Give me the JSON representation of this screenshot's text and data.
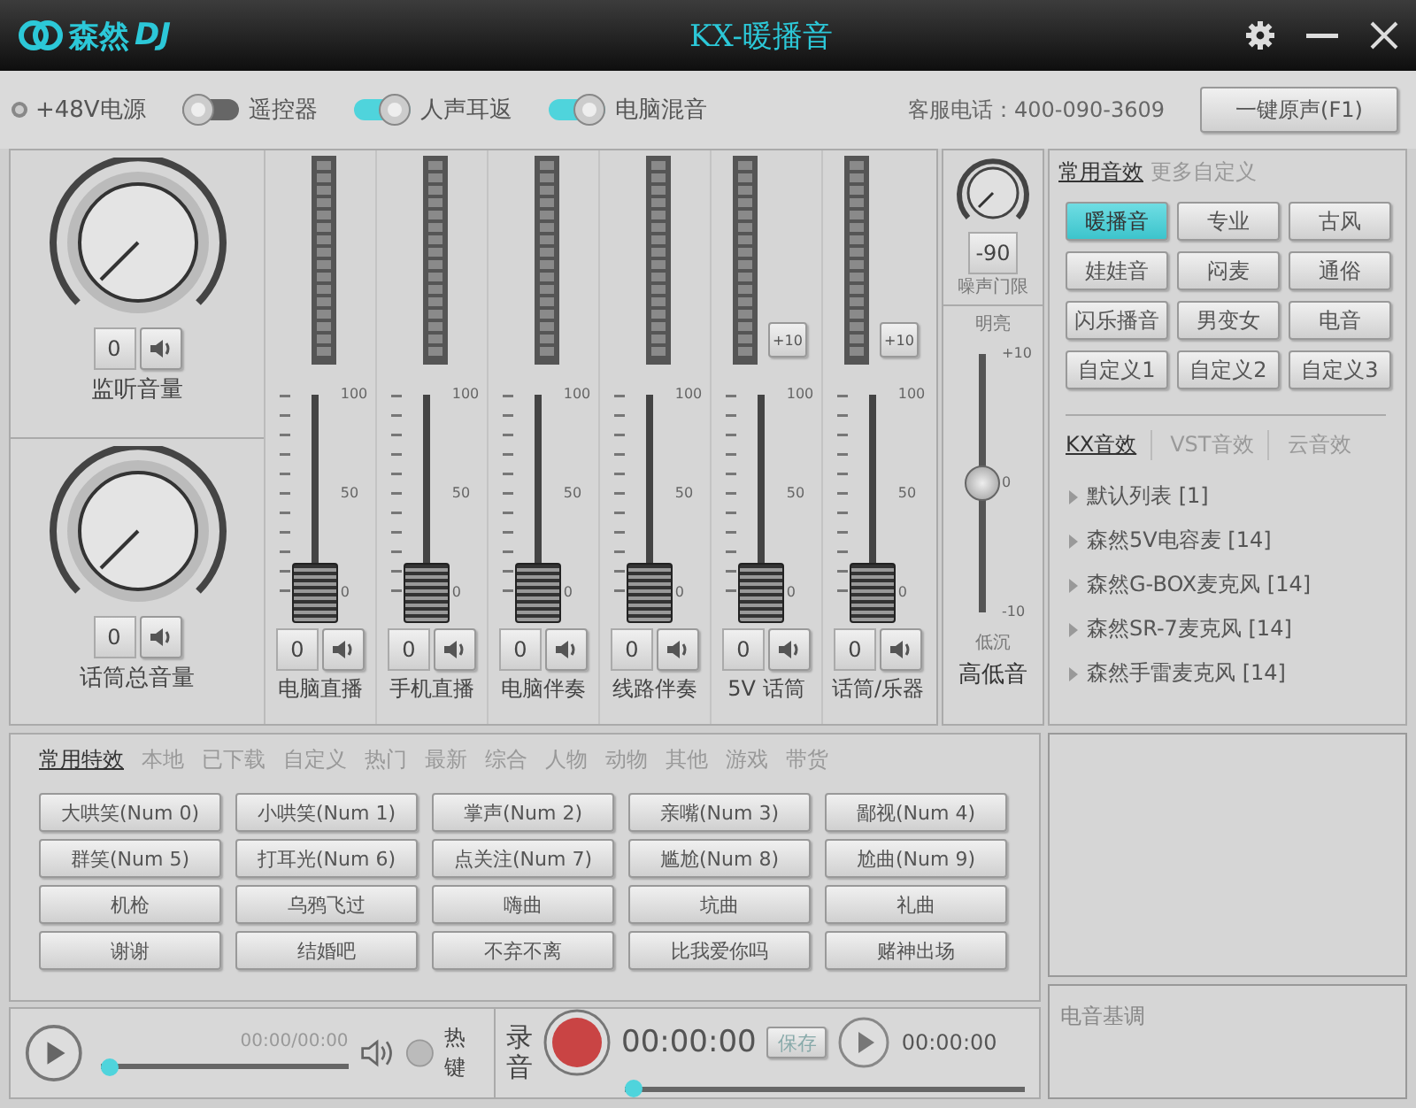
{
  "window": {
    "logo_name": "森然",
    "logo_mark": "DJ",
    "title": "KX-暖播音"
  },
  "toolbar": {
    "toggles": [
      {
        "label": "+48V电源",
        "kind": "radio",
        "on": false
      },
      {
        "label": "遥控器",
        "kind": "switch",
        "on": false
      },
      {
        "label": "人声耳返",
        "kind": "switch",
        "on": true
      },
      {
        "label": "电脑混音",
        "kind": "switch",
        "on": true
      }
    ],
    "hotline": "客服电话：400-090-3609",
    "restore_button": "一键原声(F1)"
  },
  "knobs": [
    {
      "label": "监听音量",
      "value": "0",
      "muted": false
    },
    {
      "label": "话筒总音量",
      "value": "0",
      "muted": false
    }
  ],
  "channels": [
    {
      "label": "电脑直播",
      "value": "0",
      "level": 0,
      "scale": [
        "100",
        "50",
        "0"
      ]
    },
    {
      "label": "手机直播",
      "value": "0",
      "level": 0,
      "scale": [
        "100",
        "50",
        "0"
      ]
    },
    {
      "label": "电脑伴奏",
      "value": "0",
      "level": 0,
      "scale": [
        "100",
        "50",
        "0"
      ]
    },
    {
      "label": "线路伴奏",
      "value": "0",
      "level": 0,
      "scale": [
        "100",
        "50",
        "0"
      ]
    },
    {
      "label": "5V 话筒",
      "value": "0",
      "boost": "+10",
      "level": 0,
      "scale": [
        "100",
        "50",
        "0"
      ]
    },
    {
      "label": "话筒/乐器",
      "value": "0",
      "boost": "+10",
      "level": 0,
      "scale": [
        "100",
        "50",
        "0"
      ]
    }
  ],
  "tone": {
    "gate_value": "-90",
    "gate_label": "噪声门限",
    "top_label": "明亮",
    "scale": [
      "+10",
      "0",
      "-10"
    ],
    "bottom_label": "低沉",
    "level": 0.5,
    "label": "高低音"
  },
  "effects": {
    "tabs": [
      {
        "label": "常用音效",
        "selected": true
      },
      {
        "label": "更多自定义",
        "selected": false
      }
    ],
    "presets": [
      {
        "label": "暖播音",
        "selected": true
      },
      {
        "label": "专业",
        "selected": false
      },
      {
        "label": "古风",
        "selected": false
      },
      {
        "label": "娃娃音",
        "selected": false
      },
      {
        "label": "闷麦",
        "selected": false
      },
      {
        "label": "通俗",
        "selected": false
      },
      {
        "label": "闪乐播音",
        "selected": false
      },
      {
        "label": "男变女",
        "selected": false
      },
      {
        "label": "电音",
        "selected": false
      },
      {
        "label": "自定义1",
        "selected": false
      },
      {
        "label": "自定义2",
        "selected": false
      },
      {
        "label": "自定义3",
        "selected": false
      }
    ],
    "sources": [
      {
        "label": "KX音效",
        "selected": true
      },
      {
        "label": "VST音效",
        "selected": false
      },
      {
        "label": "云音效",
        "selected": false
      }
    ],
    "list": [
      "默认列表 [1]",
      "森然5V电容麦 [14]",
      "森然G-BOX麦克风 [14]",
      "森然SR-7麦克风 [14]",
      "森然手雷麦克风 [14]"
    ]
  },
  "sound_fx": {
    "tabs": [
      {
        "label": "常用特效",
        "selected": true
      },
      {
        "label": "本地",
        "selected": false
      },
      {
        "label": "已下载",
        "selected": false
      },
      {
        "label": "自定义",
        "selected": false
      },
      {
        "label": "热门",
        "selected": false
      },
      {
        "label": "最新",
        "selected": false
      },
      {
        "label": "综合",
        "selected": false
      },
      {
        "label": "人物",
        "selected": false
      },
      {
        "label": "动物",
        "selected": false
      },
      {
        "label": "其他",
        "selected": false
      },
      {
        "label": "游戏",
        "selected": false
      },
      {
        "label": "带货",
        "selected": false
      }
    ],
    "buttons": [
      "大哄笑(Num 0)",
      "小哄笑(Num 1)",
      "掌声(Num 2)",
      "亲嘴(Num 3)",
      "鄙视(Num 4)",
      "群笑(Num 5)",
      "打耳光(Num 6)",
      "点关注(Num 7)",
      "尴尬(Num 8)",
      "尬曲(Num 9)",
      "机枪",
      "乌鸦飞过",
      "嗨曲",
      "坑曲",
      "礼曲",
      "谢谢",
      "结婚吧",
      "不弃不离",
      "比我爱你吗",
      "赌神出场"
    ]
  },
  "player": {
    "time": "00:00/00:00",
    "level": 0,
    "hotkey_label": "热键",
    "hotkey_on": false
  },
  "recorder": {
    "label": "录音",
    "time": "00:00:00",
    "save_button": "保存",
    "play_time": "00:00:00",
    "level": 0
  },
  "side": {
    "label": "电音基调"
  }
}
